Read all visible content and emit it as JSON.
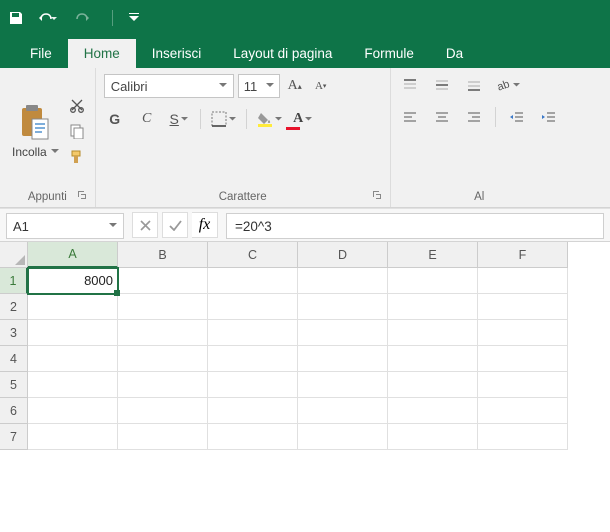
{
  "qat": {},
  "tabs": {
    "file": "File",
    "home": "Home",
    "insert": "Inserisci",
    "pagelayout": "Layout di pagina",
    "formulas": "Formule",
    "data": "Da"
  },
  "ribbon": {
    "clipboard": {
      "paste_label": "Incolla",
      "group_label": "Appunti"
    },
    "font": {
      "name": "Calibri",
      "size": "11",
      "group_label": "Carattere"
    },
    "alignment": {
      "group_label": "Al"
    }
  },
  "formula_bar": {
    "namebox": "A1",
    "fx_label": "fx",
    "formula": "=20^3"
  },
  "grid": {
    "columns": [
      "A",
      "B",
      "C",
      "D",
      "E",
      "F"
    ],
    "rows": [
      "1",
      "2",
      "3",
      "4",
      "5",
      "6",
      "7"
    ],
    "active": "A1",
    "cells": {
      "A1": "8000"
    }
  }
}
